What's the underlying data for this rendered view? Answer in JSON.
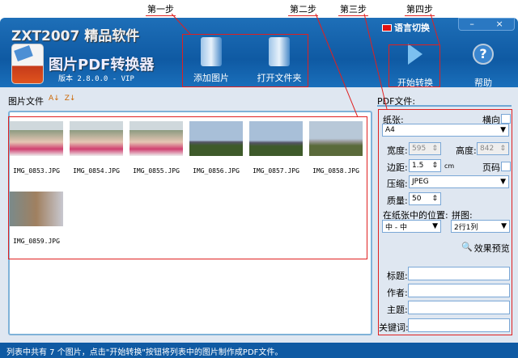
{
  "annotations": {
    "step1": "第一步",
    "step2": "第二步",
    "step3": "第三步",
    "step4": "第四步",
    "color": "#e02020"
  },
  "header": {
    "brand": "ZXT2007 精品软件",
    "app_title": "图片PDF转换器",
    "version": "版本 2.8.0.0 - VIP",
    "language": "语言切换",
    "minimize": "–",
    "close": "×"
  },
  "toolbar": {
    "add_images": "添加图片",
    "open_folder": "打开文件夹",
    "start_convert": "开始转换",
    "help": "帮助"
  },
  "left": {
    "label": "图片文件",
    "sort_az": "A↓",
    "sort_za": "Z↓",
    "files": [
      "IMG_0853.JPG",
      "IMG_0854.JPG",
      "IMG_0855.JPG",
      "IMG_0856.JPG",
      "IMG_0857.JPG",
      "IMG_0858.JPG",
      "IMG_0859.JPG"
    ]
  },
  "right": {
    "label": "PDF文件:",
    "paper_label": "纸张:",
    "landscape_label": "横向",
    "paper_value": "A4",
    "width_label": "宽度:",
    "width_value": "595",
    "height_label": "高度:",
    "height_value": "842",
    "margin_label": "边距:",
    "margin_value": "1.5",
    "margin_unit": "cm",
    "page_num_label": "页码",
    "compress_label": "压缩:",
    "compress_value": "JPEG",
    "quality_label": "质量:",
    "quality_value": "50",
    "position_label": "在纸张中的位置:",
    "position_value": "中 - 中",
    "tile_label": "拼图:",
    "tile_value": "2行1列",
    "preview": "效果预览",
    "title_label": "标题:",
    "author_label": "作者:",
    "subject_label": "主题:",
    "keywords_label": "关键词:"
  },
  "status": "列表中共有 7 个图片，点击\"开始转换\"按钮将列表中的图片制作成PDF文件。"
}
